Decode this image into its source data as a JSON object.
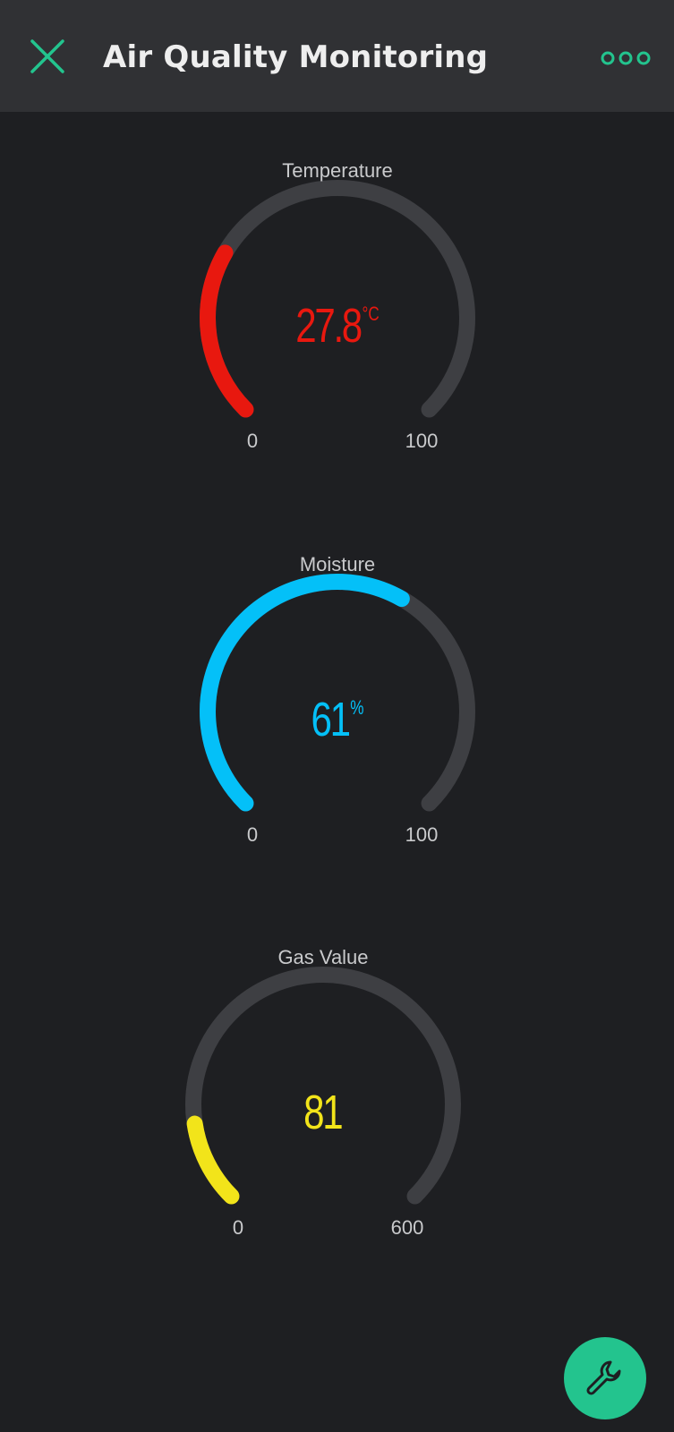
{
  "header": {
    "title": "Air Quality Monitoring",
    "close_icon": "close-icon",
    "more_icon": "more-dots-icon",
    "accent_color": "#23c48e"
  },
  "gauges": [
    {
      "label": "Temperature",
      "value": "27.8",
      "numeric_value": 27.8,
      "unit": "°C",
      "min": "0",
      "max": "100",
      "min_num": 0,
      "max_num": 100,
      "color": "#e8180f"
    },
    {
      "label": "Moisture",
      "value": "61",
      "numeric_value": 61,
      "unit": "%",
      "min": "0",
      "max": "100",
      "min_num": 0,
      "max_num": 100,
      "color": "#04c0f8"
    },
    {
      "label": "Gas Value",
      "value": "81",
      "numeric_value": 81,
      "unit": "",
      "min": "0",
      "max": "600",
      "min_num": 0,
      "max_num": 600,
      "color": "#f2e41a"
    }
  ],
  "fab": {
    "icon": "wrench-icon",
    "color": "#23c48e"
  }
}
